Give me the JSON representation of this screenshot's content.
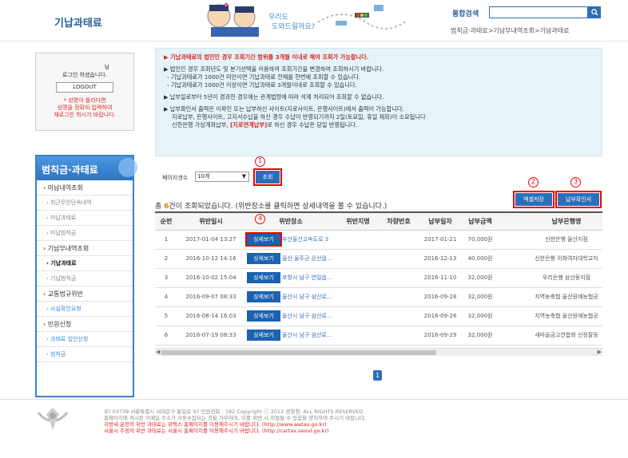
{
  "header": {
    "site_title": "기납과태료",
    "search_label": "통합검색",
    "search_icon": "search-icon",
    "breadcrumb": "범칙금·과태료>기납부내역조회>기납과태료"
  },
  "login": {
    "user_suffix": "님",
    "message": "로그인 하셨습니다.",
    "logout_label": "LOGOUT",
    "warning": "* 성명이 틀리다면\n성명을 정확히 입력하여\n재로그인 하시기 바랍니다."
  },
  "sidebar": {
    "title": "범칙금·과태료",
    "items": [
      {
        "label": "› 미납내역조회",
        "kind": "main"
      },
      {
        "label": "› 최근무인단속내역",
        "kind": "sub"
      },
      {
        "label": "› 미납과태료",
        "kind": "sub"
      },
      {
        "label": "› 미납범칙금",
        "kind": "sub"
      },
      {
        "label": "› 기납부내역조회",
        "kind": "main"
      },
      {
        "label": "› 기납과태료",
        "kind": "active"
      },
      {
        "label": "› 기납범칙금",
        "kind": "sub"
      },
      {
        "label": "› 교통법규위반",
        "kind": "main"
      },
      {
        "label": "› 사실확인요청",
        "kind": "link"
      },
      {
        "label": "› 민원신청",
        "kind": "main"
      },
      {
        "label": "› 과태료 업인신청",
        "kind": "link"
      },
      {
        "label": "› 범칙금",
        "kind": "link"
      }
    ]
  },
  "notice": {
    "line1": "▶ 기납과태료의 법인인 경우 조회기간 범위를 3개월 이내로 해야 조회가 가능합니다.",
    "line2": "▶ 법인인 경우 조회년도 및 분기선택을 이용하여 조회기간을 변경하여 조회하시기 바랍니다.",
    "line3": "- 기납과태료가 1000건 미만이면 기납과태료 전체를 한번에 조회할 수 있습니다.",
    "line4": "- 기납과태료가 1000건 이상이면 기납과태료 3개월이내로 조회할 수 있습니다.",
    "line5": "▶ 납부일로부터 5년이 경과한 경우에는 관계법령에 따라 삭제 처리되어 조회할 수 없습니다.",
    "line6": "▶ 납부확인서 출력은 이파인 또는 납부하신 사이트(지로사이트, 은행사이트)에서 출력이 가능합니다.",
    "line7": "지로납부, 은행사이트, 고지서수납을 하신 경우 수납이 반영되기까지 2일(토요일, 휴일 제외)이 소요됩니다",
    "line8a": "신한은행 가상계좌납부,",
    "line8b": "[지로연계납부]",
    "line8c": "로 하신 경우 수납은 당일 반영됩니다."
  },
  "controls": {
    "page_size_label": "페이지갯수",
    "page_size_value": "10개",
    "query_button": "조회",
    "excel_button": "엑셀저장",
    "receipt_button": "납부확인서",
    "annotations": [
      "1",
      "2",
      "3",
      "4"
    ]
  },
  "result": {
    "prefix": "총 ",
    "count": "6",
    "suffix": "건이 조회되었습니다. (위반장소를 클릭하면 상세내역을 볼 수 있습니다.)"
  },
  "table": {
    "headers": [
      "순번",
      "위반일시",
      "위반장소",
      "위반지명",
      "차량번호",
      "납부일자",
      "납부금액",
      "납부은행명"
    ],
    "detail_label": "상세보기",
    "rows": [
      {
        "no": "1",
        "datetime": "2017-01-04 13:27",
        "place": "부산울산고속도로 3",
        "area": "",
        "car": "",
        "paydate": "2017-01-21",
        "amount": "70,000원",
        "bank": "신한은행 울산지점"
      },
      {
        "no": "2",
        "datetime": "2016-10-12 14:16",
        "place": "울산 울주군 온산읍…",
        "area": "",
        "car": "",
        "paydate": "2016-12-13",
        "amount": "40,000원",
        "bank": "신한은행 이화여자대학교지"
      },
      {
        "no": "3",
        "datetime": "2016-10-02 15:04",
        "place": "포항시 남구 연일읍…",
        "area": "",
        "car": "",
        "paydate": "2016-11-10",
        "amount": "32,000원",
        "bank": "우리은행 삼산동지점"
      },
      {
        "no": "4",
        "datetime": "2016-09-07 08:33",
        "place": "울산시 남구 삼산로…",
        "area": "",
        "car": "",
        "paydate": "2016-09-28",
        "amount": "32,000원",
        "bank": "지역농축협 울산원예농협공"
      },
      {
        "no": "5",
        "datetime": "2016-08-14 16:03",
        "place": "울산시 남구 삼산로…",
        "area": "",
        "car": "",
        "paydate": "2016-09-28",
        "amount": "32,000원",
        "bank": "지역농축협 울산원예농협공"
      },
      {
        "no": "6",
        "datetime": "2016-07-19 08:33",
        "place": "울산시 남구 삼산로…",
        "area": "",
        "car": "",
        "paydate": "2016-09-29",
        "amount": "32,000원",
        "bank": "새마을금고연합회 신정팔등"
      }
    ]
  },
  "pagination": {
    "current": "1"
  },
  "footer": {
    "line1": "우) 03739 서울특별시 서대문구 통일로 97 민원전화 : 182      Copyright ⓒ 2012 경찰청, ALL RIGHTS RESERVED",
    "line2": "홈페이지에 게시된 이메일 주소가 자동수집되는 것을 거부하며, 이를 위반 시 처벌될 수 있음을 양지하여 주시기 바랍니다.",
    "line3": "지방세 운전의 위반 과태료는 위택스 홈페이지를 이용해주시기 바랍니다. (http://www.wetax.go.kr)",
    "line4": "서울시 주정차 위반 과태료는 서울시 홈페이지를 이용해주시기 바랍니다. (http://cartax.seoul.go.kr)"
  },
  "colors": {
    "accent": "#2a6fb8",
    "highlight": "#e00000",
    "notice_bg": "#e6f4f9"
  }
}
